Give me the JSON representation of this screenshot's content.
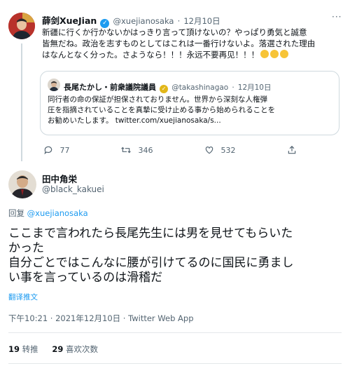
{
  "tweet1": {
    "display_name": "薛剑XueJian",
    "handle": "@xuejianosaka",
    "separator": "·",
    "date": "12月10日",
    "text_lines": [
      "新疆に行くか行かないかはっきり言って頂けないの？やっぱり勇気と誠意",
      "皆無だね。政治を志すものとしてはこれは一番行けないよ。落選された理由",
      "はなんとなく分った。さようなら！！！永远不要再见！！！"
    ],
    "emoji": [
      "hug-emoji",
      "hug-emoji",
      "hug-emoji"
    ],
    "quote": {
      "display_name": "長尾たかし・前衆議院議員",
      "handle": "@takashinagao",
      "separator": "·",
      "date": "12月10日",
      "text_lines": [
        "同行者の命の保証が担保されておりません。世界から深刻な人権弾",
        "圧を指摘されていることを真摯に受け止める事から始められることを",
        "お勧めいたします。 twitter.com/xuejianosaka/s..."
      ]
    },
    "actions": {
      "replies": "77",
      "retweets": "346",
      "likes": "532"
    }
  },
  "tweet2": {
    "display_name": "田中角栄",
    "handle": "@black_kakuei",
    "reply_prefix": "回复",
    "reply_to": "@xuejianosaka",
    "text_lines": [
      "ここまで言われたら長尾先生には男を見せてもらいた",
      "かった",
      "自分ごとではこんなに腰が引けてるのに国民に勇まし",
      "い事を言っているのは滑稽だ"
    ],
    "translate_label": "翻译推文",
    "meta": "下午10:21 · 2021年12月10日 · Twitter Web App",
    "stats": {
      "retweets_count": "19",
      "retweets_label": "转推",
      "likes_count": "29",
      "likes_label": "喜欢次数"
    }
  },
  "colors": {
    "link": "#1d9bf0",
    "muted": "#536471",
    "verified": "#1d9bf0",
    "gold_badge": "#e2b719",
    "divider": "#e4e8ea"
  }
}
